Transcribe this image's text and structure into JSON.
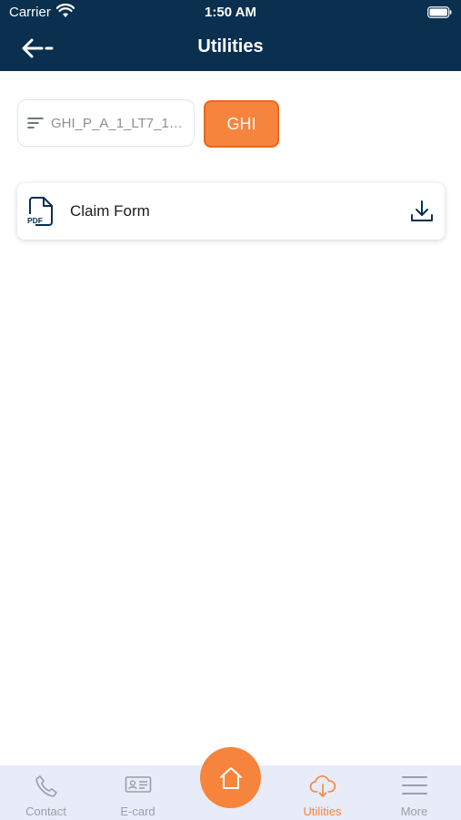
{
  "status_bar": {
    "carrier": "Carrier",
    "time": "1:50 AM"
  },
  "nav": {
    "title": "Utilities",
    "back_icon": "arrow-left-icon"
  },
  "filter": {
    "policy_value": "GHI_P_A_1_LT7_120...",
    "filter_icon": "filter-lines-icon",
    "type_button_label": "GHI"
  },
  "documents": [
    {
      "title": "Claim Form",
      "file_icon": "pdf-file-icon",
      "action_icon": "download-icon"
    }
  ],
  "tabs": [
    {
      "label": "Contact",
      "icon": "phone-icon",
      "active": false
    },
    {
      "label": "E-card",
      "icon": "id-card-icon",
      "active": false
    },
    {
      "label": "",
      "icon": "home-icon",
      "active": false
    },
    {
      "label": "Utilities",
      "icon": "cloud-download-icon",
      "active": true
    },
    {
      "label": "More",
      "icon": "menu-icon",
      "active": false
    }
  ],
  "colors": {
    "header_bg": "#0a2f4f",
    "accent": "#f7843d",
    "tab_bar_bg": "#e8ebf8",
    "inactive_tab": "#9aa0a8"
  }
}
